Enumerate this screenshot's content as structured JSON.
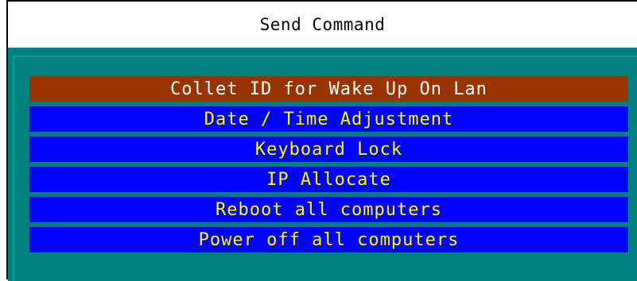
{
  "window": {
    "title": "Send Command"
  },
  "colors": {
    "title_bg": "#ffffff",
    "panel_bg": "#008080",
    "item_bg": "#0000ff",
    "item_text": "#ffff00",
    "selected_bg": "#993300",
    "selected_text": "#ffffff"
  },
  "menu": {
    "selected_index": 0,
    "items": [
      {
        "label": "Collet ID for Wake Up On Lan"
      },
      {
        "label": "Date / Time Adjustment"
      },
      {
        "label": "Keyboard Lock"
      },
      {
        "label": "IP Allocate"
      },
      {
        "label": "Reboot all computers"
      },
      {
        "label": "Power off all computers"
      }
    ]
  }
}
